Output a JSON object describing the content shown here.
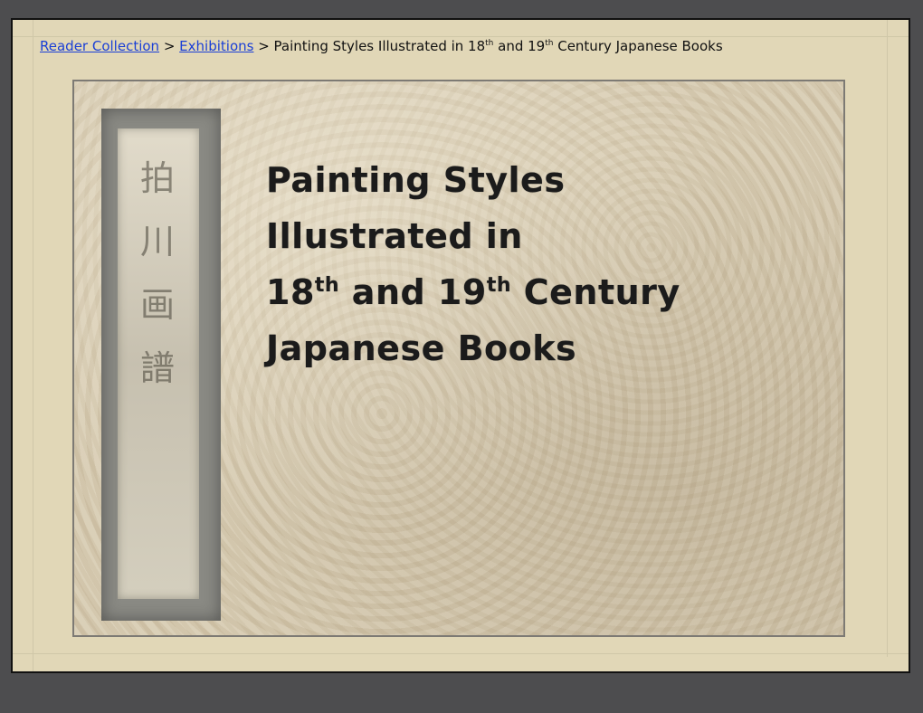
{
  "breadcrumb": {
    "link1": "Reader Collection",
    "sep1": " > ",
    "link2": "Exhibitions",
    "sep2": " > ",
    "current_a": "Painting Styles Illustrated in 18",
    "sup1": "th",
    "current_b": " and 19",
    "sup2": "th",
    "current_c": " Century Japanese Books"
  },
  "cover": {
    "line1": "Painting Styles",
    "line2": "Illustrated in",
    "line3_a": "18",
    "line3_sup1": "th",
    "line3_b": " and 19",
    "line3_sup2": "th",
    "line3_c": " Century",
    "line4": "Japanese Books",
    "slip_glyphs": "拍 川 画 譜"
  },
  "colors": {
    "background": "#4d4d4f",
    "page": "#e1d7b7",
    "link": "#1a3fd6"
  }
}
